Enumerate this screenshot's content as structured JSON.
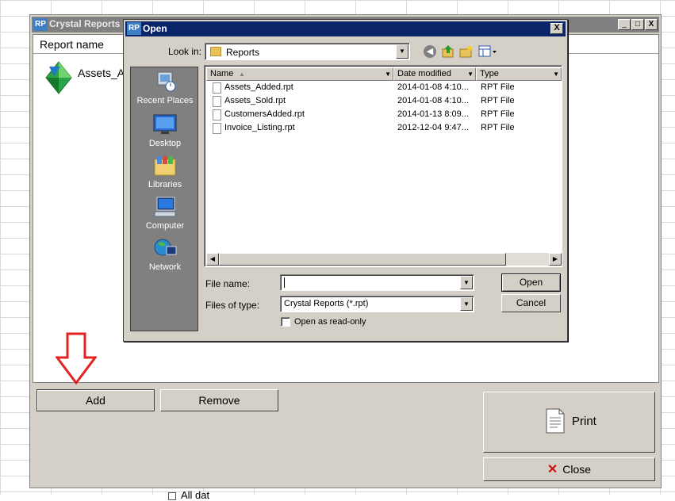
{
  "app": {
    "badge": "RP",
    "title": "Crystal Reports",
    "window_controls": [
      "_",
      "□",
      "X"
    ],
    "list_header": "Report name",
    "report_item": "Assets_Ad",
    "buttons": {
      "add": "Add",
      "remove": "Remove",
      "print": "Print",
      "close": "Close"
    },
    "below_text": "All dat"
  },
  "dialog": {
    "badge": "RP",
    "title": "Open",
    "close": "X",
    "look_in_label": "Look in:",
    "look_in_value": "Reports",
    "places": [
      {
        "label": "Recent Places",
        "icon": "recent-places-icon"
      },
      {
        "label": "Desktop",
        "icon": "desktop-icon"
      },
      {
        "label": "Libraries",
        "icon": "libraries-icon"
      },
      {
        "label": "Computer",
        "icon": "computer-icon"
      },
      {
        "label": "Network",
        "icon": "network-icon"
      }
    ],
    "columns": [
      "Name",
      "Date modified",
      "Type"
    ],
    "files": [
      {
        "name": "Assets_Added.rpt",
        "date": "2014-01-08 4:10...",
        "type": "RPT File"
      },
      {
        "name": "Assets_Sold.rpt",
        "date": "2014-01-08 4:10...",
        "type": "RPT File"
      },
      {
        "name": "CustomersAdded.rpt",
        "date": "2014-01-13 8:09...",
        "type": "RPT File"
      },
      {
        "name": "Invoice_Listing.rpt",
        "date": "2012-12-04 9:47...",
        "type": "RPT File"
      }
    ],
    "file_name_label": "File name:",
    "file_name_value": "",
    "files_of_type_label": "Files of type:",
    "files_of_type_value": "Crystal Reports (*.rpt)",
    "read_only_label": "Open as read-only",
    "open_button": "Open",
    "cancel_button": "Cancel"
  }
}
